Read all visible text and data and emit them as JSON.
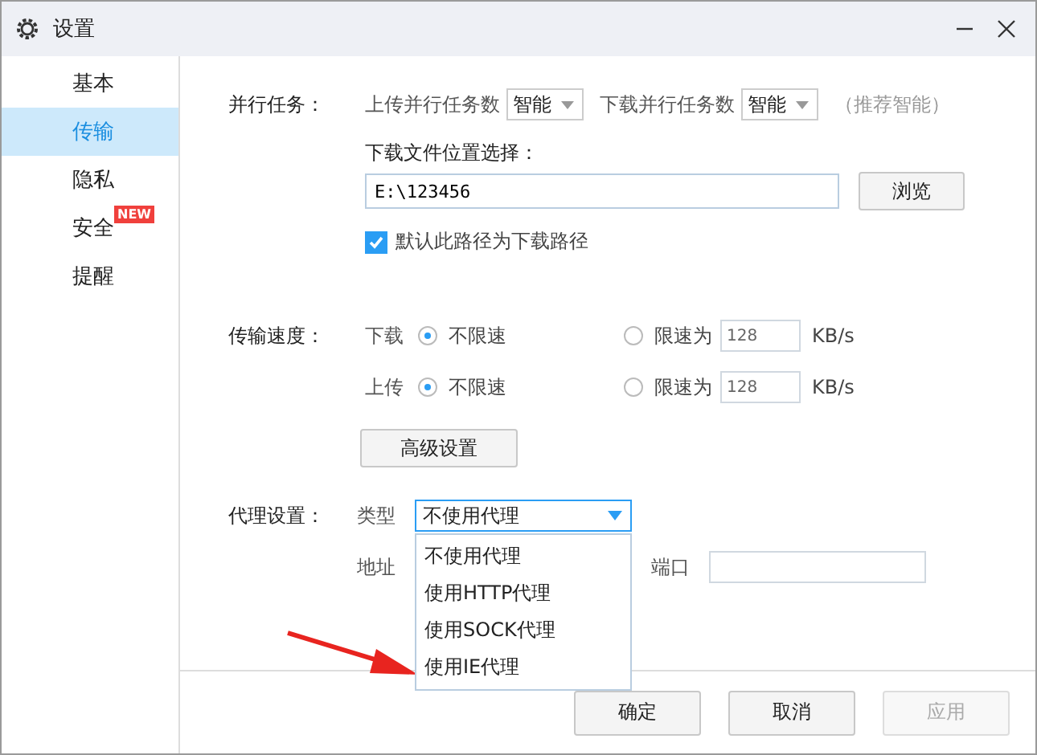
{
  "window": {
    "title": "设置"
  },
  "sidebar": {
    "items": [
      {
        "label": "基本",
        "selected": false
      },
      {
        "label": "传输",
        "selected": true
      },
      {
        "label": "隐私",
        "selected": false
      },
      {
        "label": "安全",
        "selected": false,
        "badge": "NEW"
      },
      {
        "label": "提醒",
        "selected": false
      }
    ]
  },
  "parallel_tasks": {
    "label": "并行任务：",
    "upload_label": "上传并行任务数",
    "upload_value": "智能",
    "download_label": "下载并行任务数",
    "download_value": "智能",
    "hint": "（推荐智能）"
  },
  "download_location": {
    "label": "下载文件位置选择：",
    "path": "E:\\123456",
    "browse_button": "浏览",
    "default_checkbox": {
      "label": "默认此路径为下载路径",
      "checked": true
    }
  },
  "transfer_speed": {
    "label": "传输速度：",
    "rows": [
      {
        "direction": "下载",
        "options": [
          {
            "label": "不限速",
            "selected": true
          },
          {
            "label": "限速为",
            "selected": false
          }
        ],
        "limit_value": "128",
        "unit": "KB/s"
      },
      {
        "direction": "上传",
        "options": [
          {
            "label": "不限速",
            "selected": true
          },
          {
            "label": "限速为",
            "selected": false
          }
        ],
        "limit_value": "128",
        "unit": "KB/s"
      }
    ]
  },
  "advanced_button": "高级设置",
  "proxy": {
    "label": "代理设置：",
    "type_label": "类型",
    "type_value": "不使用代理",
    "expanded": true,
    "options": [
      {
        "label": "不使用代理",
        "selected": false
      },
      {
        "label": "使用HTTP代理",
        "selected": false
      },
      {
        "label": "使用SOCK代理",
        "selected": false
      },
      {
        "label": "使用IE代理",
        "selected": false
      }
    ],
    "address_label": "地址",
    "port_label": "端口"
  },
  "footer_buttons": [
    {
      "label": "确定",
      "disabled": false
    },
    {
      "label": "取消",
      "disabled": false
    },
    {
      "label": "应用",
      "disabled": true
    }
  ]
}
